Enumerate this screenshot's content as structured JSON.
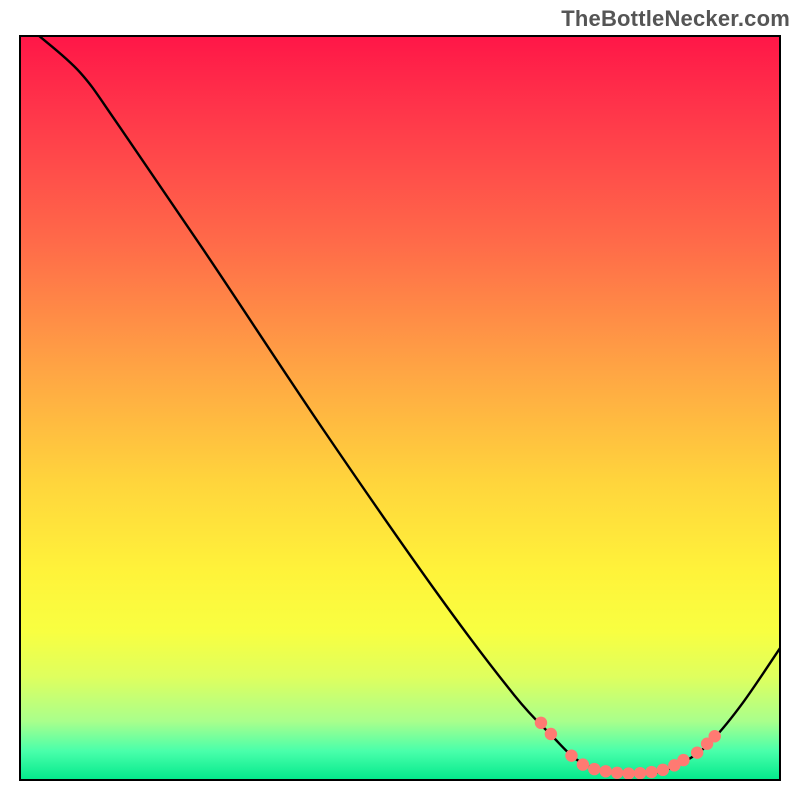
{
  "watermark": "TheBottleNecker.com",
  "chart_data": {
    "type": "line",
    "title": "",
    "xlabel": "",
    "ylabel": "",
    "xlim": [
      0,
      100
    ],
    "ylim": [
      0,
      100
    ],
    "grid": false,
    "curve": {
      "name": "bottleneck-curve",
      "points": [
        {
          "x": 2.5,
          "y": 100.0
        },
        {
          "x": 8.0,
          "y": 95.0
        },
        {
          "x": 13.0,
          "y": 88.0
        },
        {
          "x": 25.0,
          "y": 70.0
        },
        {
          "x": 40.0,
          "y": 47.0
        },
        {
          "x": 55.0,
          "y": 25.0
        },
        {
          "x": 65.0,
          "y": 11.5
        },
        {
          "x": 70.0,
          "y": 6.0
        },
        {
          "x": 73.0,
          "y": 3.0
        },
        {
          "x": 76.0,
          "y": 1.5
        },
        {
          "x": 80.0,
          "y": 1.0
        },
        {
          "x": 84.0,
          "y": 1.2
        },
        {
          "x": 88.0,
          "y": 3.0
        },
        {
          "x": 91.0,
          "y": 5.5
        },
        {
          "x": 95.0,
          "y": 10.5
        },
        {
          "x": 100.0,
          "y": 18.0
        }
      ]
    },
    "markers": [
      {
        "x": 68.5,
        "y": 7.8
      },
      {
        "x": 69.8,
        "y": 6.3
      },
      {
        "x": 72.5,
        "y": 3.4
      },
      {
        "x": 74.0,
        "y": 2.2
      },
      {
        "x": 75.5,
        "y": 1.6
      },
      {
        "x": 77.0,
        "y": 1.3
      },
      {
        "x": 78.5,
        "y": 1.1
      },
      {
        "x": 80.0,
        "y": 1.0
      },
      {
        "x": 81.5,
        "y": 1.05
      },
      {
        "x": 83.0,
        "y": 1.2
      },
      {
        "x": 84.5,
        "y": 1.5
      },
      {
        "x": 86.0,
        "y": 2.1
      },
      {
        "x": 87.2,
        "y": 2.8
      },
      {
        "x": 89.0,
        "y": 3.8
      },
      {
        "x": 90.3,
        "y": 5.0
      },
      {
        "x": 91.3,
        "y": 6.0
      }
    ]
  }
}
